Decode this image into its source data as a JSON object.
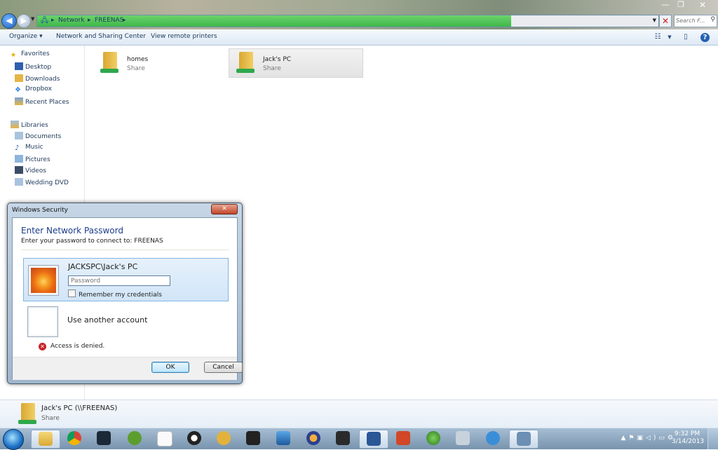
{
  "window": {
    "controls": {
      "minimize": "—",
      "maximize": "❐",
      "close": "✕"
    }
  },
  "address": {
    "crumbs": [
      "Network",
      "FREENAS"
    ],
    "search_placeholder": "Search F..."
  },
  "toolbar": {
    "organize": "Organize ▾",
    "network_sharing": "Network and Sharing Center",
    "view_printers": "View remote printers"
  },
  "sidebar": {
    "favorites_header": "Favorites",
    "favorites": [
      "Desktop",
      "Downloads",
      "Dropbox",
      "Recent Places"
    ],
    "libraries_header": "Libraries",
    "libraries": [
      "Documents",
      "Music",
      "Pictures",
      "Videos",
      "Wedding DVD"
    ]
  },
  "content": {
    "items": [
      {
        "name": "homes",
        "type": "Share"
      },
      {
        "name": "Jack's PC",
        "type": "Share"
      }
    ]
  },
  "details": {
    "name": "Jack's PC (\\\\FREENAS)",
    "type": "Share"
  },
  "dialog": {
    "title": "Windows Security",
    "close": "✕",
    "heading": "Enter Network Password",
    "subtitle": "Enter your password to connect to: FREENAS",
    "username": "JACKSPC\\Jack's PC",
    "password_placeholder": "Password",
    "remember": "Remember my credentials",
    "other_account": "Use another account",
    "error": "Access is denied.",
    "ok": "OK",
    "cancel": "Cancel"
  },
  "clock": {
    "time": "9:32 PM",
    "date": "3/14/2013"
  },
  "colors": {
    "address_progress": "#3fb74a",
    "dialog_heading": "#1c3a8a",
    "error_icon": "#c8222a"
  }
}
